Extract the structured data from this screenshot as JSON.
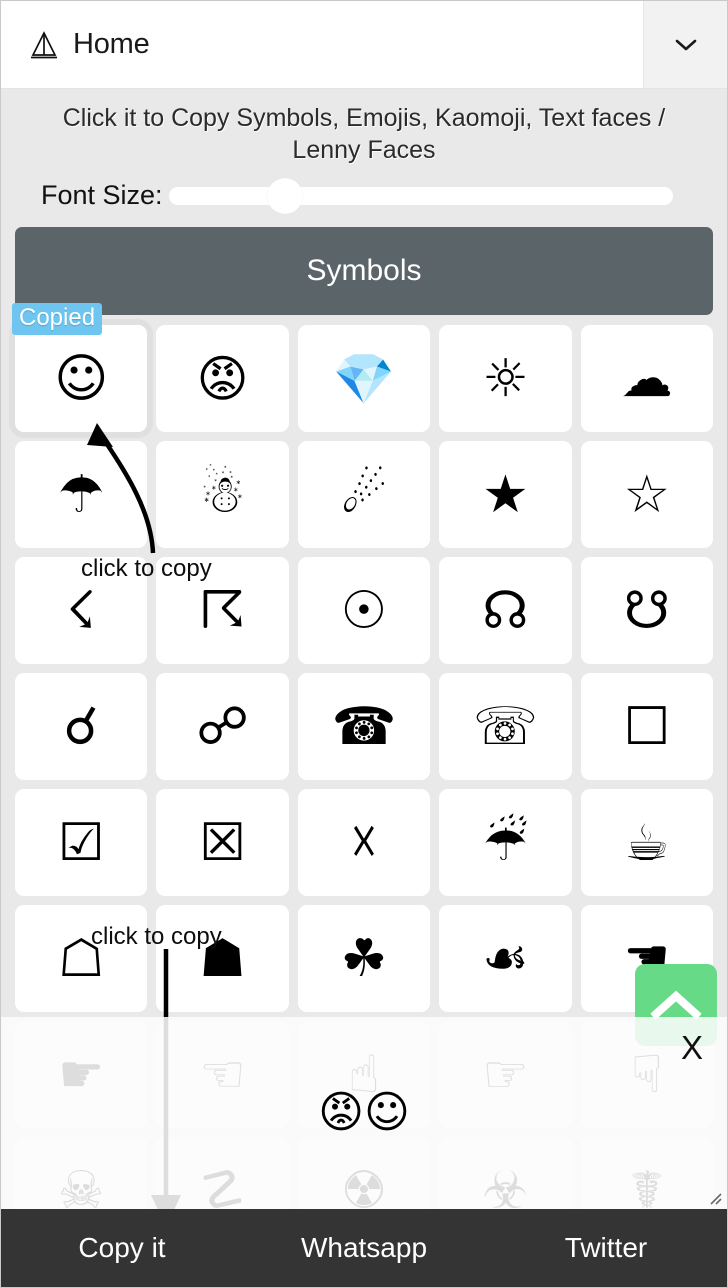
{
  "header": {
    "title": "Home",
    "home_icon": "triangle-underline-icon",
    "dropdown_icon": "chevron-down-icon"
  },
  "intro": {
    "tagline": "Click it to Copy Symbols, Emojis, Kaomoji, Text faces / Lenny Faces",
    "font_size_label": "Font Size:",
    "font_size_percent": 23
  },
  "section": {
    "title": "Symbols"
  },
  "badges": {
    "copied": "Copied"
  },
  "annotations": {
    "first": "click to copy",
    "second": "click to copy"
  },
  "grid": {
    "rows": [
      [
        {
          "glyph": "☺",
          "name": "white-smiling-face",
          "emoji": false,
          "copied": true
        },
        {
          "glyph": "😡",
          "name": "pouting-face-emoji",
          "emoji": true,
          "copied": false
        },
        {
          "glyph": "💎",
          "name": "gem-stone-emoji",
          "emoji": true,
          "copied": false
        },
        {
          "glyph": "☼",
          "name": "white-sun-with-rays",
          "emoji": false,
          "copied": false
        },
        {
          "glyph": "☁",
          "name": "cloud-symbol",
          "emoji": false,
          "copied": false
        }
      ],
      [
        {
          "glyph": "☂",
          "name": "umbrella-symbol",
          "emoji": false,
          "copied": false
        },
        {
          "glyph": "☃",
          "name": "snowman-symbol",
          "emoji": false,
          "copied": false
        },
        {
          "glyph": "☄",
          "name": "comet-symbol",
          "emoji": false,
          "copied": false
        },
        {
          "glyph": "★",
          "name": "black-star",
          "emoji": false,
          "copied": false
        },
        {
          "glyph": "☆",
          "name": "white-star",
          "emoji": false,
          "copied": false
        }
      ],
      [
        {
          "glyph": "☇",
          "name": "lightning-symbol",
          "emoji": false,
          "copied": false
        },
        {
          "glyph": "☈",
          "name": "thunderstorm-symbol",
          "emoji": false,
          "copied": false
        },
        {
          "glyph": "☉",
          "name": "sun-symbol",
          "emoji": false,
          "copied": false
        },
        {
          "glyph": "☊",
          "name": "ascending-node-symbol",
          "emoji": false,
          "copied": false
        },
        {
          "glyph": "☋",
          "name": "descending-node-symbol",
          "emoji": false,
          "copied": false
        }
      ],
      [
        {
          "glyph": "☌",
          "name": "conjunction-symbol",
          "emoji": false,
          "copied": false
        },
        {
          "glyph": "☍",
          "name": "opposition-symbol",
          "emoji": false,
          "copied": false
        },
        {
          "glyph": "☎",
          "name": "black-telephone-symbol",
          "emoji": false,
          "copied": false
        },
        {
          "glyph": "☏",
          "name": "white-telephone-symbol",
          "emoji": false,
          "copied": false
        },
        {
          "glyph": "☐",
          "name": "ballot-box-symbol",
          "emoji": false,
          "copied": false
        }
      ],
      [
        {
          "glyph": "☑",
          "name": "ballot-box-with-check",
          "emoji": false,
          "copied": false
        },
        {
          "glyph": "☒",
          "name": "ballot-box-with-x",
          "emoji": false,
          "copied": false
        },
        {
          "glyph": "☓",
          "name": "saltire-symbol",
          "emoji": false,
          "copied": false
        },
        {
          "glyph": "☔",
          "name": "umbrella-with-rain-emoji",
          "emoji": true,
          "copied": false
        },
        {
          "glyph": "☕",
          "name": "hot-beverage-emoji",
          "emoji": true,
          "copied": false
        }
      ],
      [
        {
          "glyph": "☖",
          "name": "white-shogi-piece",
          "emoji": false,
          "copied": false
        },
        {
          "glyph": "☗",
          "name": "black-shogi-piece",
          "emoji": false,
          "copied": false
        },
        {
          "glyph": "☘",
          "name": "shamrock-symbol",
          "emoji": false,
          "copied": false
        },
        {
          "glyph": "☙",
          "name": "reversed-floral-heart-symbol",
          "emoji": false,
          "copied": false
        },
        {
          "glyph": "☚",
          "name": "black-left-pointing-index",
          "emoji": false,
          "copied": false
        }
      ],
      [
        {
          "glyph": "☛",
          "name": "black-right-pointing-index",
          "emoji": false,
          "copied": false
        },
        {
          "glyph": "☜",
          "name": "white-left-pointing-index",
          "emoji": false,
          "copied": false
        },
        {
          "glyph": "☝",
          "name": "white-up-pointing-index",
          "emoji": false,
          "copied": false
        },
        {
          "glyph": "☞",
          "name": "white-right-pointing-index",
          "emoji": false,
          "copied": false
        },
        {
          "glyph": "☟",
          "name": "white-down-pointing-index",
          "emoji": false,
          "copied": false
        }
      ],
      [
        {
          "glyph": "☠",
          "name": "skull-and-crossbones",
          "emoji": false,
          "copied": false
        },
        {
          "glyph": "☡",
          "name": "caution-sign",
          "emoji": false,
          "copied": false
        },
        {
          "glyph": "☢",
          "name": "radioactive-sign",
          "emoji": false,
          "copied": false
        },
        {
          "glyph": "☣",
          "name": "biohazard-sign",
          "emoji": false,
          "copied": false
        },
        {
          "glyph": "☤",
          "name": "caduceus-symbol",
          "emoji": false,
          "copied": false
        }
      ]
    ]
  },
  "overlay": {
    "copied_text": "😡☺",
    "close_label": "X"
  },
  "bottom_bar": {
    "actions": [
      {
        "label": "Copy it",
        "name": "copy-it-button"
      },
      {
        "label": "Whatsapp",
        "name": "whatsapp-button"
      },
      {
        "label": "Twitter",
        "name": "twitter-button"
      }
    ]
  },
  "scroll_top": {
    "icon": "chevron-up-icon",
    "color": "#66da87"
  },
  "colors": {
    "section_bar": "#5b6468",
    "badge": "#6dc5f0",
    "bottom_bar": "#343434",
    "page_bg": "#e9e9e9"
  }
}
